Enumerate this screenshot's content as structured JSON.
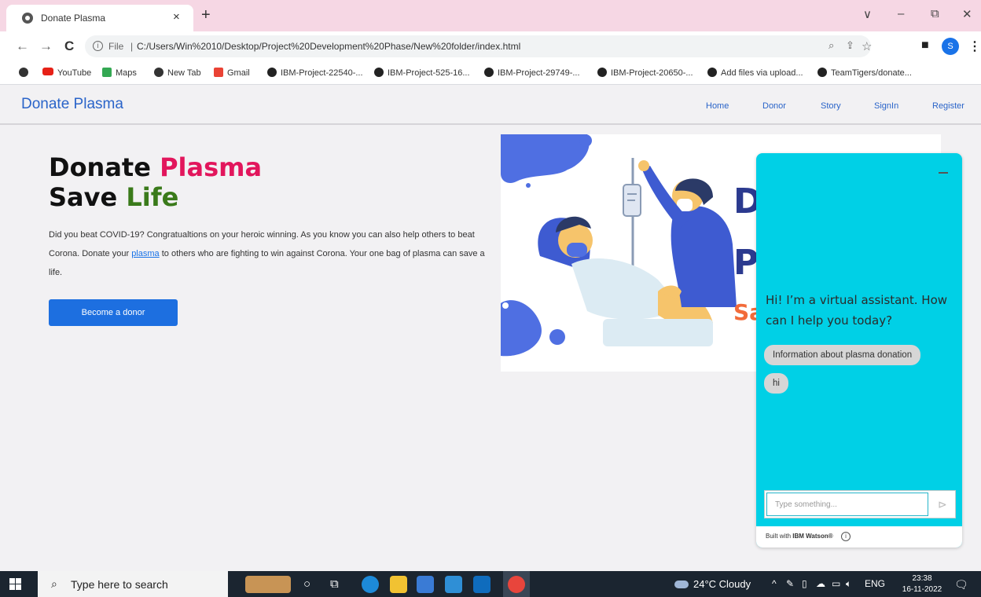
{
  "browser": {
    "tab_title": "Donate Plasma",
    "tab_close": "×",
    "new_tab": "+",
    "window_controls": [
      "∨",
      "–",
      "⧉",
      "✕"
    ],
    "nav": {
      "back": "←",
      "forward": "→",
      "reload": "C"
    },
    "address": {
      "scheme": "File",
      "url": "C:/Users/Win%2010/Desktop/Project%20Development%20Phase/New%20folder/index.html"
    },
    "profile_initial": "S",
    "bookmarks": [
      {
        "icon": "globe-icon",
        "label": ""
      },
      {
        "icon": "youtube-icon",
        "label": "YouTube"
      },
      {
        "icon": "maps-icon",
        "label": "Maps"
      },
      {
        "icon": "globe-icon",
        "label": "New Tab"
      },
      {
        "icon": "gmail-icon",
        "label": "Gmail"
      },
      {
        "icon": "github-icon",
        "label": "IBM-Project-22540-..."
      },
      {
        "icon": "github-icon",
        "label": "IBM-Project-525-16..."
      },
      {
        "icon": "github-icon",
        "label": "IBM-Project-29749-..."
      },
      {
        "icon": "github-icon",
        "label": "IBM-Project-20650-..."
      },
      {
        "icon": "github-icon",
        "label": "Add files via upload..."
      },
      {
        "icon": "github-icon",
        "label": "TeamTigers/donate..."
      }
    ]
  },
  "site": {
    "brand": "Donate Plasma",
    "nav": [
      "Home",
      "Donor",
      "Story",
      "SignIn",
      "Register"
    ],
    "hero": {
      "title_line1_a": "Donate",
      "title_line1_b": "Plasma",
      "title_line2_a": "Save",
      "title_line2_b": "Life",
      "text_before_link": "Did you beat COVID-19? Congratualtions on your heroic winning. As you know you can also help others to beat Corona. Donate your",
      "link": "plasma",
      "text_after_link": "to others who are fighting to win against Corona. Your one bag of plasma can save a life.",
      "cta": "Become a donor"
    },
    "illustration_letters": [
      "D",
      "P",
      "Sa"
    ]
  },
  "chat": {
    "greeting": "Hi! I’m a virtual assistant. How can I help you today?",
    "options": [
      "Information about plasma donation",
      "hi"
    ],
    "input_placeholder": "Type something...",
    "footer_prefix": "Built with",
    "footer_brand": "IBM Watson®",
    "colors": {
      "panel": "#00d0e6"
    }
  },
  "taskbar": {
    "search_placeholder": "Type here to search",
    "weather": "24°C  Cloudy",
    "language": "ENG",
    "time": "23:38",
    "date": "16-11-2022"
  }
}
